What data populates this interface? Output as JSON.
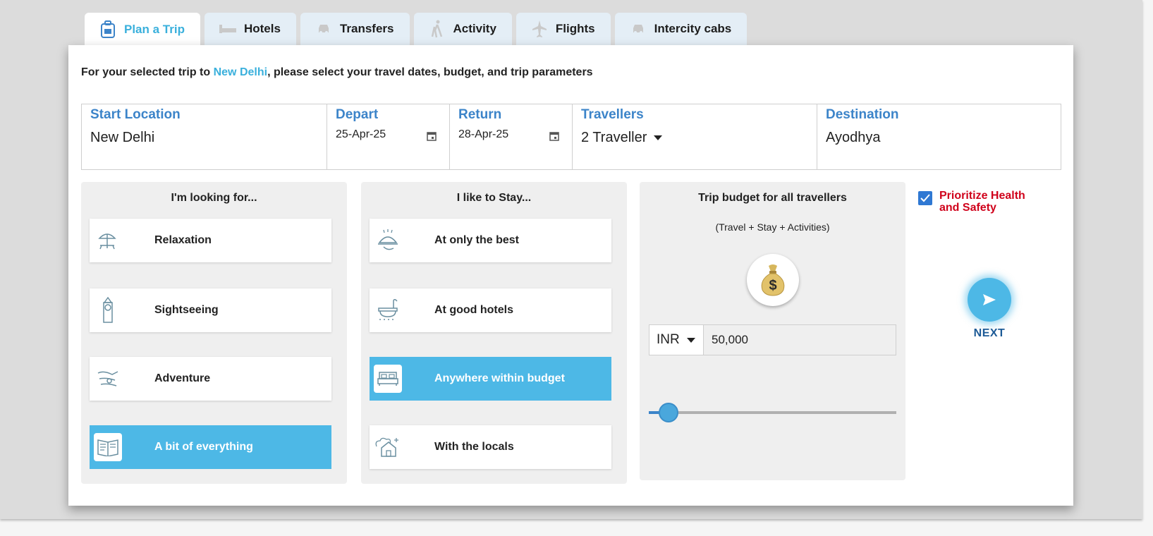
{
  "tabs": [
    {
      "label": "Plan a Trip",
      "icon": "backpack-icon",
      "active": true
    },
    {
      "label": "Hotels",
      "icon": "bed-icon"
    },
    {
      "label": "Transfers",
      "icon": "car-icon"
    },
    {
      "label": "Activity",
      "icon": "hiker-icon"
    },
    {
      "label": "Flights",
      "icon": "plane-icon"
    },
    {
      "label": "Intercity cabs",
      "icon": "cab-icon"
    }
  ],
  "intro": {
    "prefix": "For your selected trip to ",
    "city": "New Delhi",
    "suffix": ", please select your travel dates, budget, and trip parameters"
  },
  "fields": {
    "start": {
      "label": "Start Location",
      "value": "New Delhi"
    },
    "depart": {
      "label": "Depart",
      "value": "25-Apr-25"
    },
    "return": {
      "label": "Return",
      "value": "28-Apr-25"
    },
    "travellers": {
      "label": "Travellers",
      "value": "2 Traveller"
    },
    "destination": {
      "label": "Destination",
      "value": "Ayodhya"
    }
  },
  "looking": {
    "title": "I'm looking for...",
    "options": [
      {
        "label": "Relaxation",
        "icon": "beach-umbrella-icon"
      },
      {
        "label": "Sightseeing",
        "icon": "clock-tower-icon"
      },
      {
        "label": "Adventure",
        "icon": "glider-icon"
      },
      {
        "label": "A bit of everything",
        "icon": "map-book-icon",
        "selected": true
      }
    ]
  },
  "stay": {
    "title": "I like to Stay...",
    "options": [
      {
        "label": "At only the best",
        "icon": "cloche-icon"
      },
      {
        "label": "At good hotels",
        "icon": "bathtub-icon"
      },
      {
        "label": "Anywhere within budget",
        "icon": "bed-icon",
        "selected": true
      },
      {
        "label": "With the locals",
        "icon": "house-tree-icon"
      }
    ]
  },
  "budget": {
    "title": "Trip budget for all travellers",
    "subtitle": "(Travel + Stay + Activities)",
    "currency": "INR",
    "amount": "50,000",
    "slider_fraction": 0.08
  },
  "health": {
    "label": "Prioritize Health and Safety",
    "checked": true
  },
  "next": {
    "label": "NEXT"
  },
  "colors": {
    "accent": "#4db8e6",
    "label_blue": "#3c84c9",
    "alert_red": "#d0021b"
  }
}
